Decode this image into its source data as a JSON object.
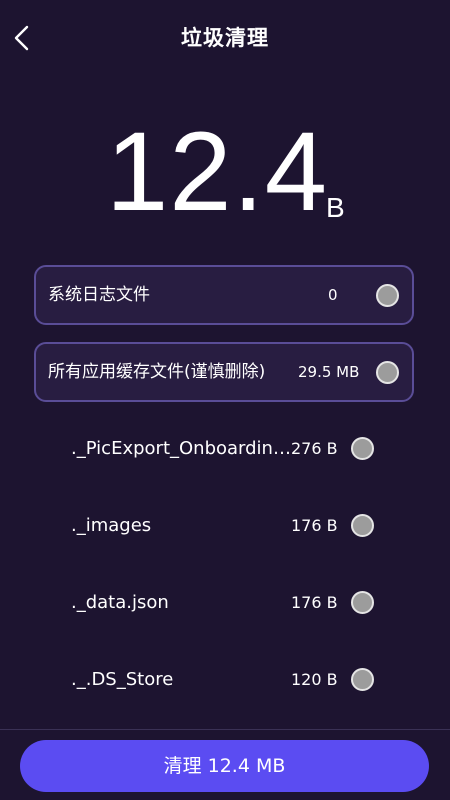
{
  "header": {
    "title": "垃圾清理"
  },
  "summary": {
    "value": "12.4",
    "unit": "B"
  },
  "categories": [
    {
      "label": "系统日志文件",
      "size": "0",
      "checked": false
    },
    {
      "label": "所有应用缓存文件(谨慎删除)",
      "size": "29.5 MB",
      "checked": false
    }
  ],
  "files": [
    {
      "name": "._PicExport_Onboardin…",
      "size": "276 B",
      "checked": false
    },
    {
      "name": "._images",
      "size": "176 B",
      "checked": false
    },
    {
      "name": "._data.json",
      "size": "176 B",
      "checked": false
    },
    {
      "name": "._.DS_Store",
      "size": "120 B",
      "checked": false
    }
  ],
  "action": {
    "clean_label": "清理 12.4 MB"
  },
  "colors": {
    "background": "#1d1430",
    "accent": "#5b4cf2",
    "card_border": "#5a4d97",
    "radio": "#9c9c9c"
  },
  "icons": {
    "back": "chevron-left-icon"
  }
}
